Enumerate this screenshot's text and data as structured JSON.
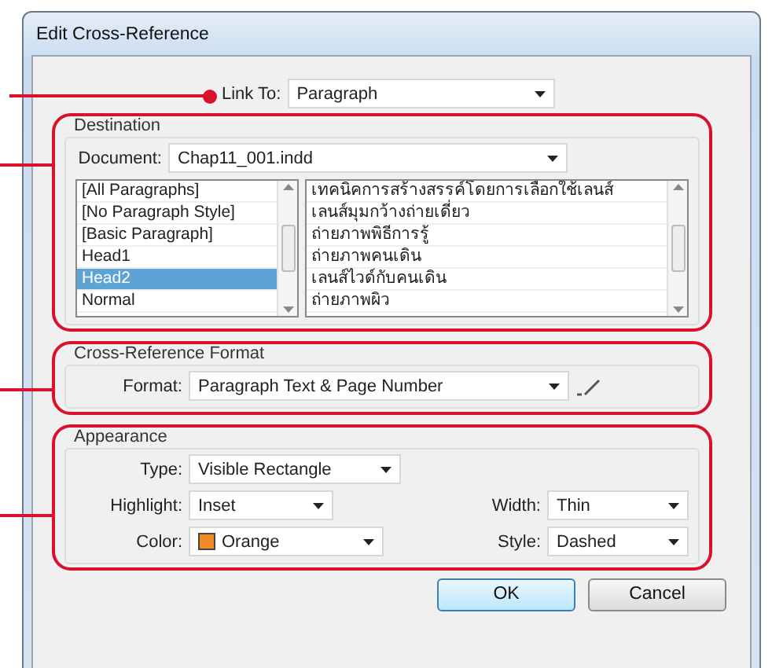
{
  "window": {
    "title": "Edit Cross-Reference"
  },
  "link_to": {
    "label": "Link To:",
    "value": "Paragraph",
    "callout": true
  },
  "destination": {
    "legend": "Destination",
    "callout": true,
    "document": {
      "label": "Document:",
      "value": "Chap11_001.indd"
    },
    "styles": [
      {
        "label": "[All Paragraphs]",
        "selected": false
      },
      {
        "label": "[No Paragraph Style]",
        "selected": false
      },
      {
        "label": "[Basic Paragraph]",
        "selected": false
      },
      {
        "label": "Head1",
        "selected": false
      },
      {
        "label": "Head2",
        "selected": true
      },
      {
        "label": "Normal",
        "selected": false
      }
    ],
    "paragraphs": [
      "เทคนิคการสร้างสรรค์โดยการเลือกใช้เลนส์",
      "เลนส์มุมกว้างถ่ายเดี่ยว",
      "ถ่ายภาพพิธีการรู้",
      "ถ่ายภาพคนเดิน",
      "เลนส์ไวด์กับคนเดิน",
      "ถ่ายภาพผิว"
    ]
  },
  "format_section": {
    "legend": "Cross-Reference Format",
    "callout": true,
    "format": {
      "label": "Format:",
      "value": "Paragraph Text & Page Number"
    }
  },
  "appearance": {
    "legend": "Appearance",
    "callout": true,
    "type": {
      "label": "Type:",
      "value": "Visible Rectangle"
    },
    "highlight": {
      "label": "Highlight:",
      "value": "Inset"
    },
    "width": {
      "label": "Width:",
      "value": "Thin"
    },
    "color": {
      "label": "Color:",
      "value": "Orange",
      "color": "#f08a24"
    },
    "style": {
      "label": "Style:",
      "value": "Dashed"
    }
  },
  "buttons": [
    {
      "label": "OK",
      "default": true
    },
    {
      "label": "Cancel",
      "default": false
    }
  ]
}
